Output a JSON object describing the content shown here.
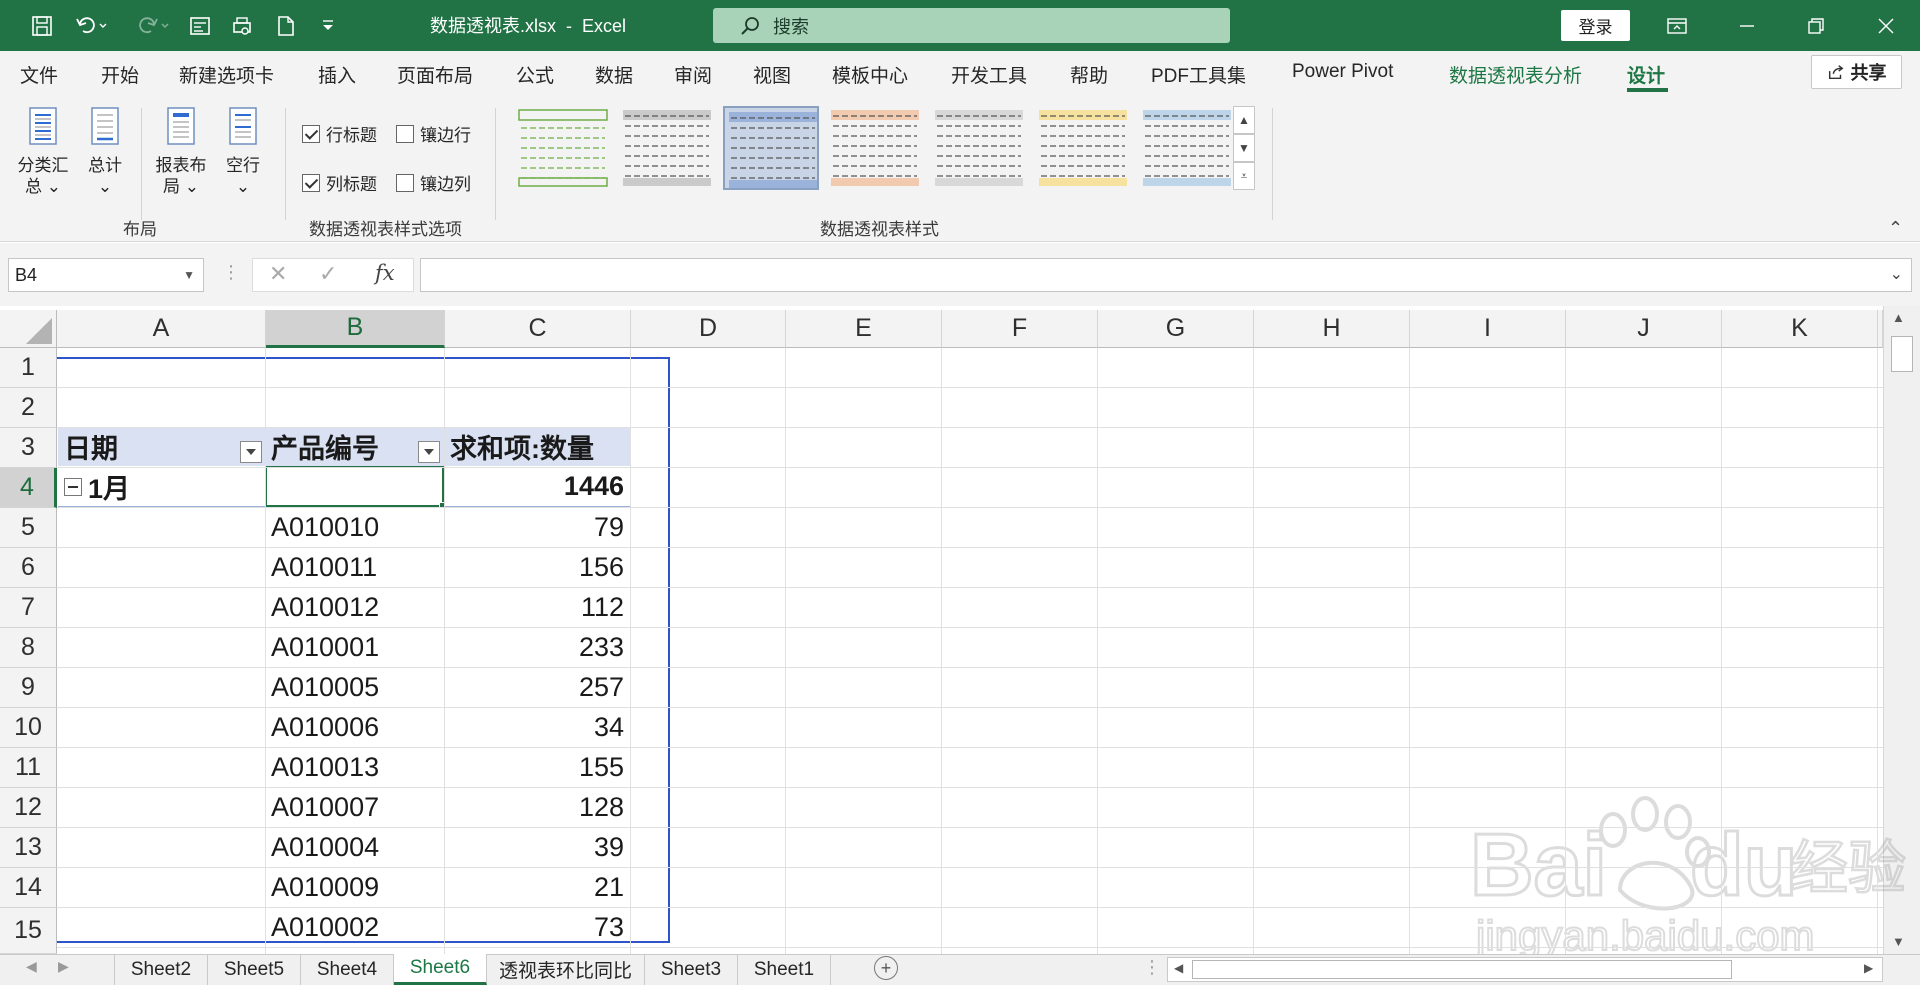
{
  "titlebar": {
    "doc_title": "数据透视表.xlsx  -  Excel",
    "search_placeholder": "搜索",
    "login": "登录"
  },
  "tabs": [
    "文件",
    "开始",
    "新建选项卡",
    "插入",
    "页面布局",
    "公式",
    "数据",
    "审阅",
    "视图",
    "模板中心",
    "开发工具",
    "帮助",
    "PDF工具集",
    "Power Pivot",
    "数据透视表分析",
    "设计"
  ],
  "share": "共享",
  "ribbon": {
    "layout": {
      "subtotal": "分类汇",
      "subtotal2": "总",
      "grandtotal": "总计",
      "report_layout": "报表布",
      "report_layout2": "局",
      "blank_rows": "空行",
      "group_label": "布局"
    },
    "style_options": {
      "row_headers": "行标题",
      "col_headers": "列标题",
      "banded_rows": "镶边行",
      "banded_cols": "镶边列",
      "group_label": "数据透视表样式选项"
    },
    "styles": {
      "group_label": "数据透视表样式",
      "colors": [
        "#70ad47",
        "#7f7f7f",
        "#4472c4",
        "#ed7d31",
        "#a5a5a5",
        "#ffc000",
        "#5b9bd5"
      ]
    }
  },
  "formula_bar": {
    "name_box": "B4",
    "fx": "fx",
    "formula": ""
  },
  "columns": [
    "A",
    "B",
    "C",
    "D",
    "E",
    "F",
    "G",
    "H",
    "I",
    "J",
    "K"
  ],
  "rows": [
    "1",
    "2",
    "3",
    "4",
    "5",
    "6",
    "7",
    "8",
    "9",
    "10",
    "11",
    "12",
    "13",
    "14",
    "15"
  ],
  "pivot": {
    "header_date": "日期",
    "header_product": "产品编号",
    "header_sum": "求和项:数量",
    "group_label": "1月",
    "group_total": "1446",
    "items": [
      {
        "product": "A010010",
        "qty": "79"
      },
      {
        "product": "A010011",
        "qty": "156"
      },
      {
        "product": "A010012",
        "qty": "112"
      },
      {
        "product": "A010001",
        "qty": "233"
      },
      {
        "product": "A010005",
        "qty": "257"
      },
      {
        "product": "A010006",
        "qty": "34"
      },
      {
        "product": "A010013",
        "qty": "155"
      },
      {
        "product": "A010007",
        "qty": "128"
      },
      {
        "product": "A010004",
        "qty": "39"
      },
      {
        "product": "A010009",
        "qty": "21"
      },
      {
        "product": "A010002",
        "qty": "73"
      }
    ]
  },
  "sheets": [
    "Sheet2",
    "Sheet5",
    "Sheet4",
    "Sheet6",
    "透视表环比同比",
    "Sheet3",
    "Sheet1"
  ],
  "active_sheet": "Sheet6",
  "watermark": {
    "brand": "Baidu经验",
    "url": "jingyan.baidu.com"
  }
}
